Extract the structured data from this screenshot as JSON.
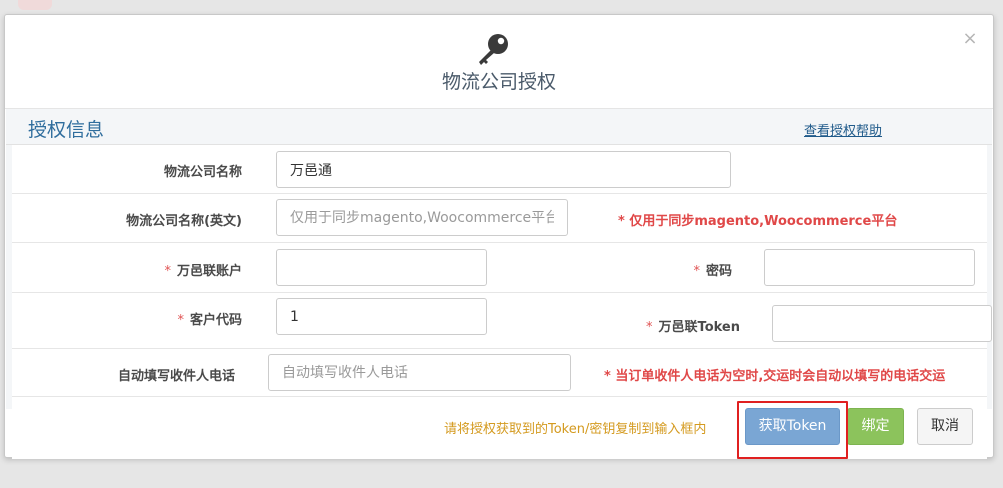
{
  "colors": {
    "accent_blue": "#2f6d9d",
    "required_red": "#e05252",
    "note_red": "#e04848",
    "hint_orange": "#d49a1f",
    "token_button": "#7aa6d4",
    "bind_button": "#8cc35c",
    "highlight_border": "#e02020"
  },
  "header": {
    "icon": "key-icon",
    "title": "物流公司授权",
    "close_icon": "close-icon",
    "close_label": "×"
  },
  "section": {
    "title": "授权信息",
    "help_link": "查看授权帮助"
  },
  "form": {
    "required_mark": "*",
    "company_name": {
      "label": "物流公司名称",
      "value": "万邑通"
    },
    "company_name_en": {
      "label": "物流公司名称(英文)",
      "value": "",
      "placeholder": "仅用于同步magento,Woocommerce平台",
      "note": "* 仅用于同步magento,Woocommerce平台"
    },
    "account": {
      "label": "万邑联账户",
      "value": ""
    },
    "password": {
      "label": "密码",
      "value": ""
    },
    "customer_code": {
      "label": "客户代码",
      "value": "1"
    },
    "token": {
      "label": "万邑联Token",
      "value": ""
    },
    "auto_phone": {
      "label": "自动填写收件人电话",
      "value": "",
      "placeholder": "自动填写收件人电话",
      "note": "* 当订单收件人电话为空时,交运时会自动以填写的电话交运"
    }
  },
  "footer": {
    "hint": "请将授权获取到的Token/密钥复制到输入框内",
    "get_token_label": "获取Token",
    "bind_label": "绑定",
    "cancel_label": "取消"
  }
}
